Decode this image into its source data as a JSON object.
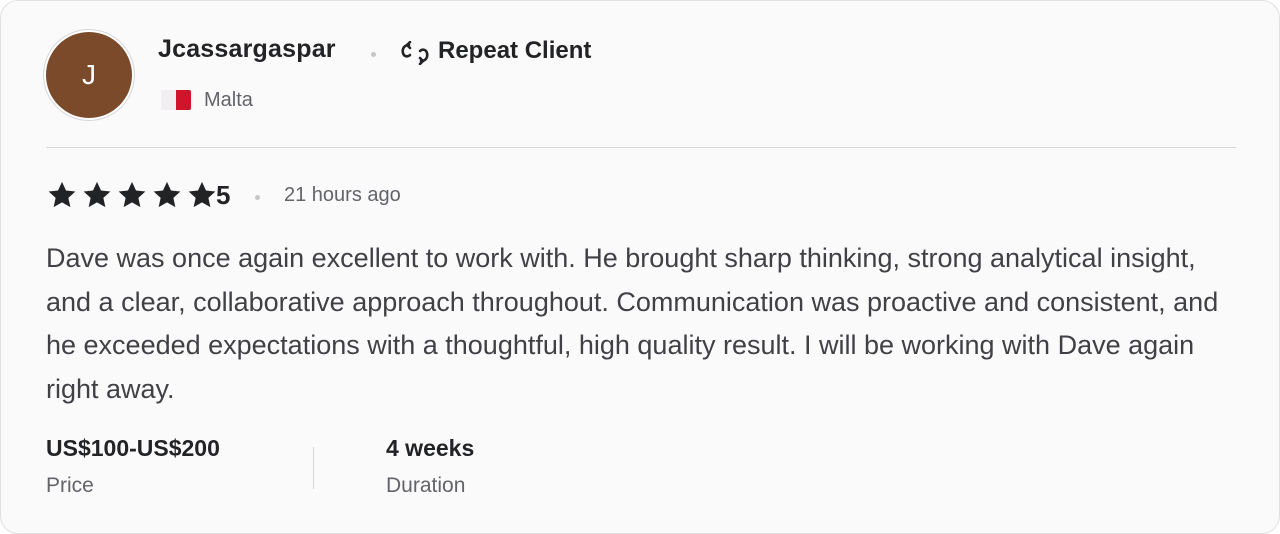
{
  "reviewer": {
    "avatar_initial": "J",
    "avatar_color": "#7a4a2b",
    "username": "Jcassargaspar",
    "badge_label": "Repeat Client",
    "badge_icon": "repeat-client-icon",
    "country": "Malta",
    "country_flag": "malta-flag-icon"
  },
  "rating": {
    "stars": 5,
    "max_stars": 5,
    "value": "5",
    "time_ago": "21 hours ago"
  },
  "review": {
    "text": "Dave was once again excellent to work with. He brought sharp thinking, strong analytical insight, and a clear, collaborative approach throughout. Communication was proactive and consistent, and he exceeded expectations with a thoughtful, high quality result. I will be working with Dave again right away."
  },
  "details": {
    "price_value": "US$100-US$200",
    "price_label": "Price",
    "duration_value": "4 weeks",
    "duration_label": "Duration"
  }
}
